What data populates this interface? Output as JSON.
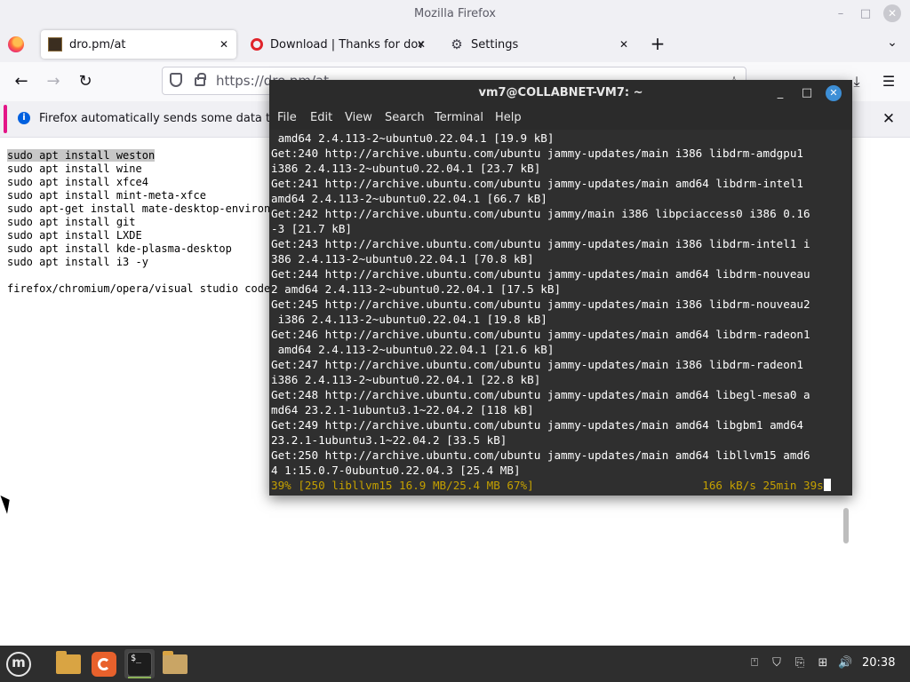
{
  "window": {
    "title": "Mozilla Firefox",
    "minimize": "–",
    "maximize": "□",
    "close": "✕"
  },
  "tabs": [
    {
      "title": "dro.pm/at",
      "close": "✕"
    },
    {
      "title": "Download | Thanks for dow",
      "close": "✕"
    },
    {
      "title": "Settings",
      "close": "✕"
    }
  ],
  "tabbar": {
    "new_tab": "+",
    "list_all": "⌄"
  },
  "nav": {
    "back": "←",
    "forward": "→",
    "reload": "↻",
    "url": "https://dro.pm/at",
    "bookmark": "☆",
    "downloads": "⤓",
    "menu": "☰"
  },
  "notification": {
    "info": "i",
    "message": "Firefox automatically sends some data to Mozilla so that we can improve your experience.",
    "close": "✕"
  },
  "page": {
    "lines": [
      "sudo apt install weston",
      "sudo apt install wine",
      "sudo apt install xfce4",
      "sudo apt install mint-meta-xfce",
      "sudo apt-get install mate-desktop-environment",
      "sudo apt install git",
      "sudo apt install LXDE",
      "sudo apt install kde-plasma-desktop",
      "sudo apt install i3 -y",
      "",
      "firefox/chromium/opera/visual studio code"
    ]
  },
  "terminal": {
    "title": "vm7@COLLABNET-VM7: ~",
    "controls": {
      "minimize": "_",
      "maximize": "□",
      "close": "✕"
    },
    "menu": [
      "File",
      "Edit",
      "View",
      "Search",
      "Terminal",
      "Help"
    ],
    "output": [
      " amd64 2.4.113-2~ubuntu0.22.04.1 [19.9 kB]",
      "Get:240 http://archive.ubuntu.com/ubuntu jammy-updates/main i386 libdrm-amdgpu1",
      "i386 2.4.113-2~ubuntu0.22.04.1 [23.7 kB]",
      "Get:241 http://archive.ubuntu.com/ubuntu jammy-updates/main amd64 libdrm-intel1",
      "amd64 2.4.113-2~ubuntu0.22.04.1 [66.7 kB]",
      "Get:242 http://archive.ubuntu.com/ubuntu jammy/main i386 libpciaccess0 i386 0.16",
      "-3 [21.7 kB]",
      "Get:243 http://archive.ubuntu.com/ubuntu jammy-updates/main i386 libdrm-intel1 i",
      "386 2.4.113-2~ubuntu0.22.04.1 [70.8 kB]",
      "Get:244 http://archive.ubuntu.com/ubuntu jammy-updates/main amd64 libdrm-nouveau",
      "2 amd64 2.4.113-2~ubuntu0.22.04.1 [17.5 kB]",
      "Get:245 http://archive.ubuntu.com/ubuntu jammy-updates/main i386 libdrm-nouveau2",
      " i386 2.4.113-2~ubuntu0.22.04.1 [19.8 kB]",
      "Get:246 http://archive.ubuntu.com/ubuntu jammy-updates/main amd64 libdrm-radeon1",
      " amd64 2.4.113-2~ubuntu0.22.04.1 [21.6 kB]",
      "Get:247 http://archive.ubuntu.com/ubuntu jammy-updates/main i386 libdrm-radeon1",
      "i386 2.4.113-2~ubuntu0.22.04.1 [22.8 kB]",
      "Get:248 http://archive.ubuntu.com/ubuntu jammy-updates/main amd64 libegl-mesa0 a",
      "md64 23.2.1-1ubuntu3.1~22.04.2 [118 kB]",
      "Get:249 http://archive.ubuntu.com/ubuntu jammy-updates/main amd64 libgbm1 amd64",
      "23.2.1-1ubuntu3.1~22.04.2 [33.5 kB]",
      "Get:250 http://archive.ubuntu.com/ubuntu jammy-updates/main amd64 libllvm15 amd6",
      "4 1:15.0.7-0ubuntu0.22.04.3 [25.4 MB]"
    ],
    "status_line": "39% [250 libllvm15 16.9 MB/25.4 MB 67%]                         166 kB/s 25min 39s"
  },
  "taskbar": {
    "clock": "20:38",
    "tray_icons": [
      "update-icon",
      "shield-icon",
      "clipboard-icon",
      "network-icon",
      "volume-icon"
    ]
  },
  "colors": {
    "terminal_bg": "#2f2f2f",
    "status_text": "#c4a000",
    "notification_accent": "#e31587",
    "taskbar_bg": "#2e2e2e"
  }
}
